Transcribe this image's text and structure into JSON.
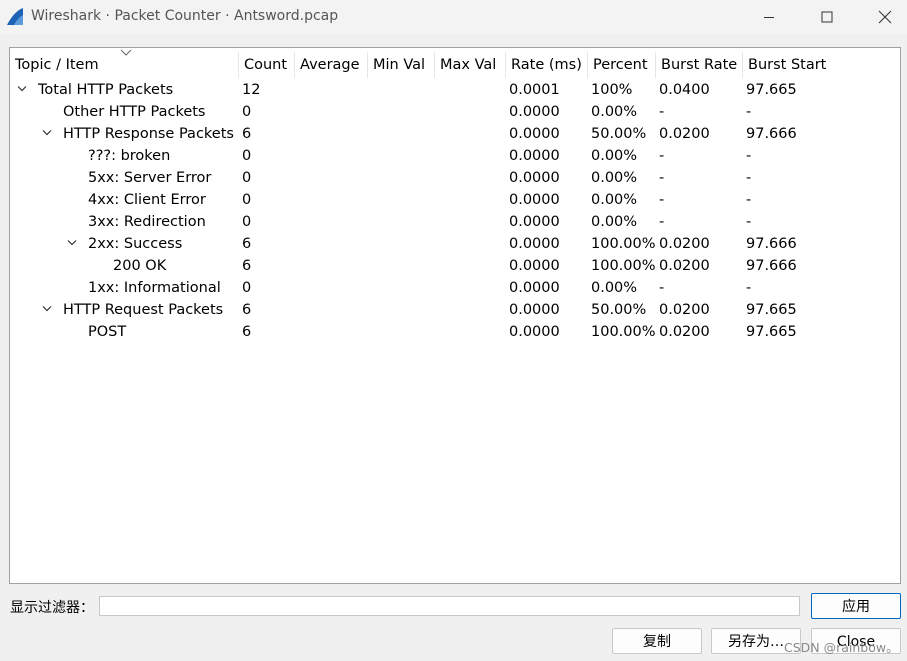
{
  "window": {
    "title": "Wireshark · Packet Counter · Antsword.pcap"
  },
  "table": {
    "columns": [
      "Topic / Item",
      "Count",
      "Average",
      "Min Val",
      "Max Val",
      "Rate (ms)",
      "Percent",
      "Burst Rate",
      "Burst Start"
    ],
    "rows": [
      {
        "item": "Total HTTP Packets",
        "count": "12",
        "rate": "0.0001",
        "percent": "100%",
        "burst_rate": "0.0400",
        "burst_start": "97.665"
      },
      {
        "item": "Other HTTP Packets",
        "count": "0",
        "rate": "0.0000",
        "percent": "0.00%",
        "burst_rate": "-",
        "burst_start": "-"
      },
      {
        "item": "HTTP Response Packets",
        "count": "6",
        "rate": "0.0000",
        "percent": "50.00%",
        "burst_rate": "0.0200",
        "burst_start": "97.666"
      },
      {
        "item": "???: broken",
        "count": "0",
        "rate": "0.0000",
        "percent": "0.00%",
        "burst_rate": "-",
        "burst_start": "-"
      },
      {
        "item": "5xx: Server Error",
        "count": "0",
        "rate": "0.0000",
        "percent": "0.00%",
        "burst_rate": "-",
        "burst_start": "-"
      },
      {
        "item": "4xx: Client Error",
        "count": "0",
        "rate": "0.0000",
        "percent": "0.00%",
        "burst_rate": "-",
        "burst_start": "-"
      },
      {
        "item": "3xx: Redirection",
        "count": "0",
        "rate": "0.0000",
        "percent": "0.00%",
        "burst_rate": "-",
        "burst_start": "-"
      },
      {
        "item": "2xx: Success",
        "count": "6",
        "rate": "0.0000",
        "percent": "100.00%",
        "burst_rate": "0.0200",
        "burst_start": "97.666"
      },
      {
        "item": "200 OK",
        "count": "6",
        "rate": "0.0000",
        "percent": "100.00%",
        "burst_rate": "0.0200",
        "burst_start": "97.666"
      },
      {
        "item": "1xx: Informational",
        "count": "0",
        "rate": "0.0000",
        "percent": "0.00%",
        "burst_rate": "-",
        "burst_start": "-"
      },
      {
        "item": "HTTP Request Packets",
        "count": "6",
        "rate": "0.0000",
        "percent": "50.00%",
        "burst_rate": "0.0200",
        "burst_start": "97.665"
      },
      {
        "item": "POST",
        "count": "6",
        "rate": "0.0000",
        "percent": "100.00%",
        "burst_rate": "0.0200",
        "burst_start": "97.665"
      }
    ]
  },
  "filter": {
    "label": "显示过滤器：",
    "value": "",
    "apply_label": "应用"
  },
  "buttons": {
    "copy_label": "复制",
    "save_as_label": "另存为…",
    "close_label": "Close"
  },
  "watermark": "CSDN @rainbow。",
  "colors": {
    "accent": "#0067c0",
    "icon_blue": "#1e63b6"
  },
  "icons": {
    "app": "shark-fin-icon",
    "expanded": "chevron-down-icon",
    "sort": "sort-descending-icon"
  }
}
